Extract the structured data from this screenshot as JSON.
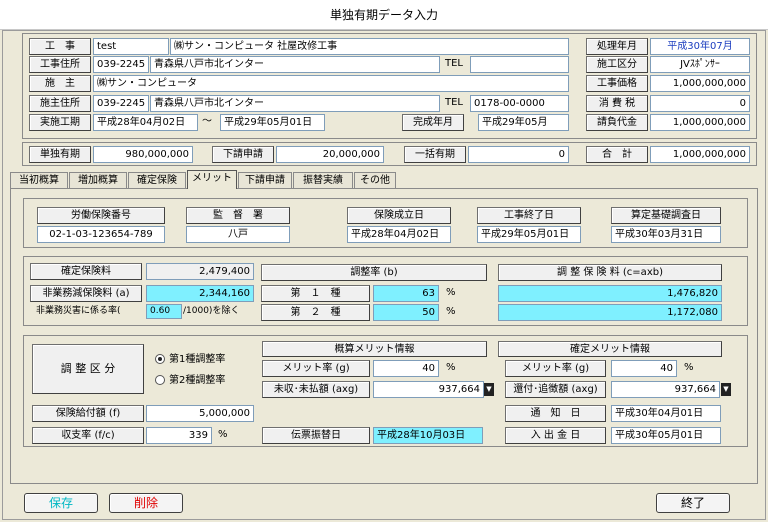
{
  "window": {
    "title": "単独有期データ入力"
  },
  "header": {
    "koji_label": "工　事",
    "koji_code": "test",
    "koji_name": "㈱サン・コンピュータ 社屋改修工事",
    "koji_addr_label": "工事住所",
    "koji_zip": "039-2245",
    "koji_addr": "青森県八戸市北インター",
    "tel_label": "TEL",
    "tel_blank": "",
    "seshu_label": "施　主",
    "seshu_name": "㈱サン・コンピュータ",
    "seshu_addr_label": "施主住所",
    "seshu_zip": "039-2245",
    "seshu_addr": "青森県八戸市北インター",
    "tel2_label": "TEL",
    "tel2_value": "0178-00-0000",
    "period_label": "実施工期",
    "period_start": "平成28年04月02日",
    "tilde": "〜",
    "period_end": "平成29年05月01日",
    "completion_label": "完成年月",
    "completion_value": "平成29年05月",
    "shori_label": "処理年月",
    "shori_value": "平成30年07月",
    "seko_label": "施工区分",
    "seko_value": "JVｽﾎﾟﾝｻｰ",
    "kakaku_label": "工事価格",
    "kakaku_value": "1,000,000,000",
    "tax_label": "消 費 税",
    "tax_value": "0",
    "ukeoi_label": "請負代金",
    "ukeoi_value": "1,000,000,000"
  },
  "totals": {
    "tandoku_label": "単独有期",
    "tandoku_value": "980,000,000",
    "shitauke_label": "下請申請",
    "shitauke_value": "20,000,000",
    "ikkatsu_label": "一括有期",
    "ikkatsu_value": "0",
    "goukei_label": "合　計",
    "goukei_value": "1,000,000,000"
  },
  "tabs": [
    {
      "label": "当初概算"
    },
    {
      "label": "増加概算"
    },
    {
      "label": "確定保険"
    },
    {
      "label": "メリット"
    },
    {
      "label": "下請申請"
    },
    {
      "label": "振替実績"
    },
    {
      "label": "その他"
    }
  ],
  "info": {
    "rodo_label": "労働保険番号",
    "rodo_value": "02-1-03-123654-789",
    "kantoku_label": "監　督　署",
    "kantoku_value": "八戸",
    "seiritsu_label": "保険成立日",
    "seiritsu_value": "平成28年04月02日",
    "shuryo_label": "工事終了日",
    "shuryo_value": "平成29年05月01日",
    "santei_label": "算定基礎調査日",
    "santei_value": "平成30年03月31日"
  },
  "adjust": {
    "kakutei_label": "確定保険料",
    "kakutei_value": "2,479,400",
    "higyomu_label": "非業務減保険料 (a)",
    "higyomu_value": "2,344,160",
    "saigai_label": "非業務災害に係る率(",
    "saigai_value": "0.60",
    "saigai_suffix": "/1000)を除く",
    "rate_header": "調整率 (b)",
    "type1_label": "第　１　種",
    "type1_value": "63",
    "type2_label": "第　２　種",
    "type2_value": "50",
    "percent": "%",
    "hokenryo_header": "調 整 保 険 料 (c=axb)",
    "hokenryo1": "1,476,820",
    "hokenryo2": "1,172,080"
  },
  "merit": {
    "kubun_label": "調 整 区 分",
    "radio1": "第1種調整率",
    "radio2": "第2種調整率",
    "gaisan_header": "概算メリット情報",
    "gaisan_rate_label": "メリット率 (g)",
    "gaisan_rate_value": "40",
    "mishu_label": "未収･未払額 (axg)",
    "mishu_value": "937,664",
    "kakutei_header": "確定メリット情報",
    "kakutei_rate_label": "メリット率 (g)",
    "kakutei_rate_value": "40",
    "kanpu_label": "還付･追徴額 (axg)",
    "kanpu_value": "937,664",
    "percent": "%",
    "kyufu_label": "保険給付額 (f)",
    "kyufu_value": "5,000,000",
    "shushi_label": "収支率 (f/c)",
    "shushi_value": "339",
    "denpyo_label": "伝票振替日",
    "denpyo_value": "平成28年10月03日",
    "tsuchi_label": "通　知　日",
    "tsuchi_value": "平成30年04月01日",
    "nyushukkin_label": "入 出 金 日",
    "nyushukkin_value": "平成30年05月01日"
  },
  "footer": {
    "save_label": "保存",
    "delete_label": "削除",
    "close_label": "終了",
    "save_color": "#00b7c3",
    "delete_color": "#e00000"
  }
}
